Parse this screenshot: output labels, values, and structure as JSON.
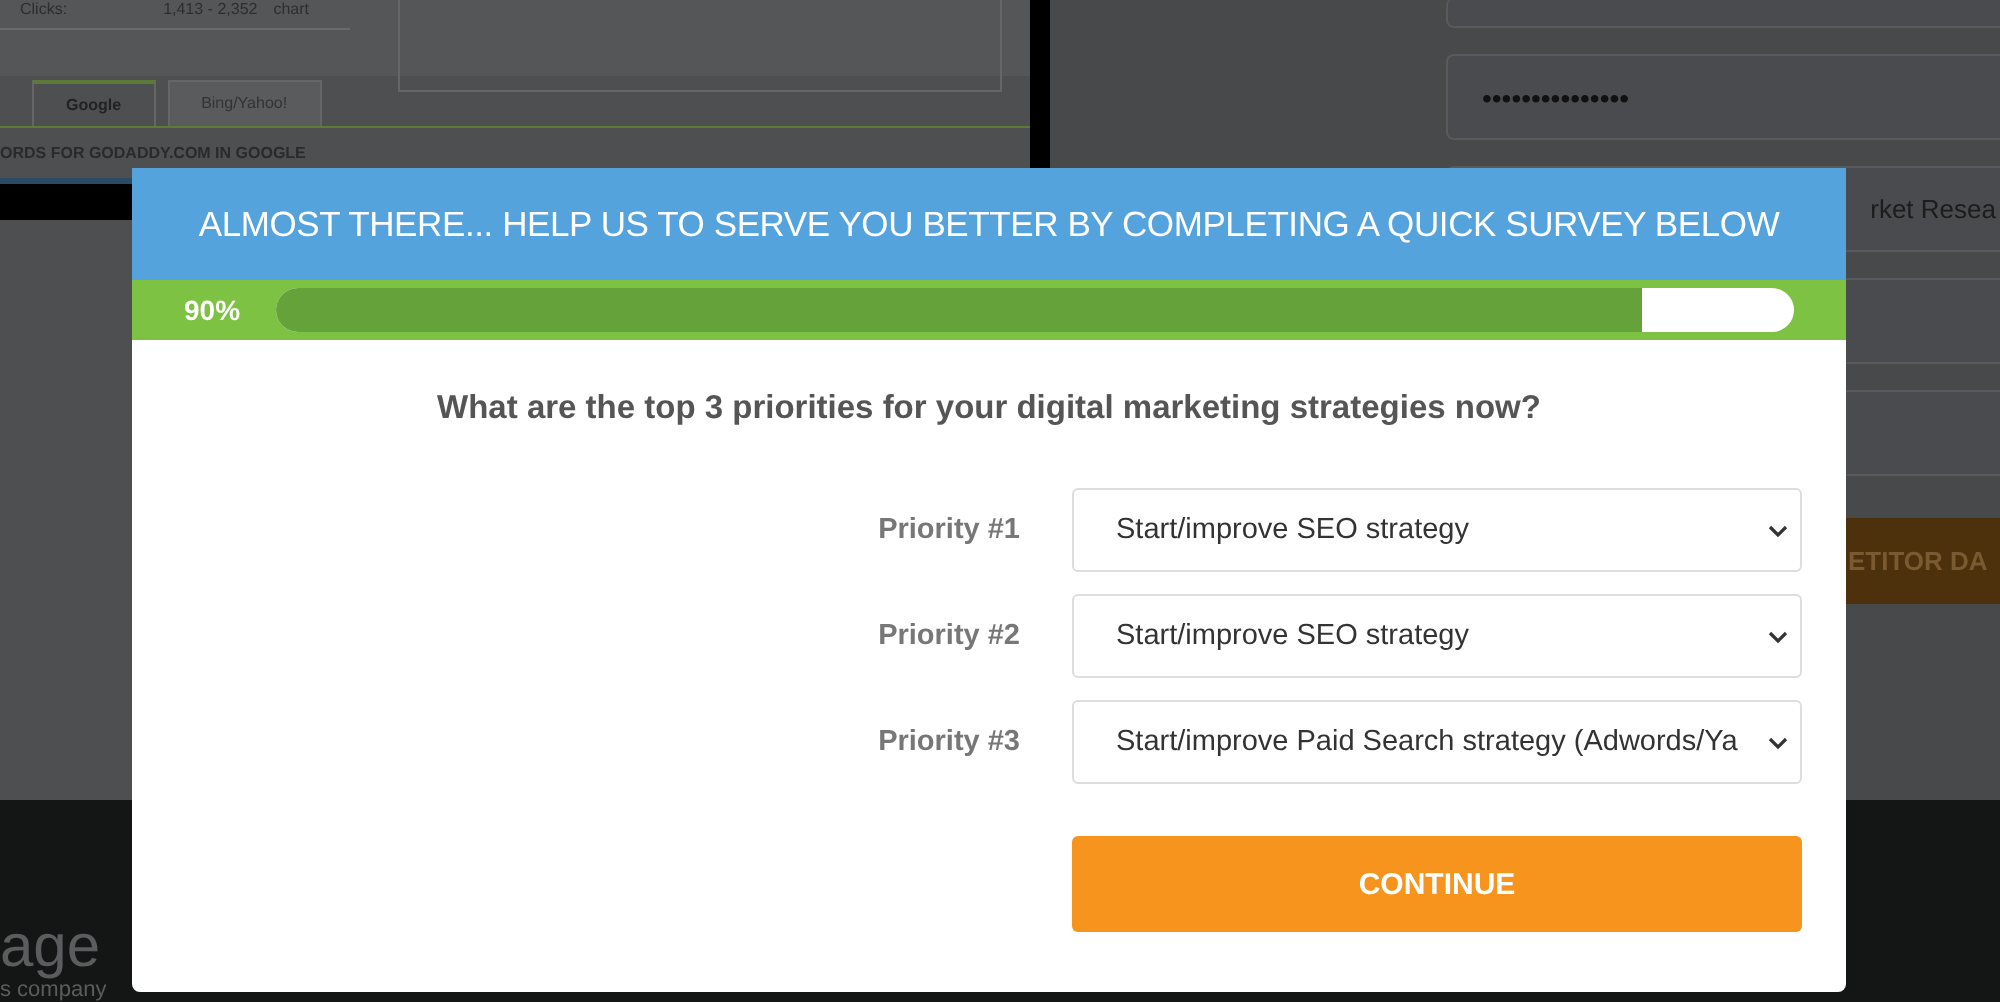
{
  "background": {
    "stats": {
      "label": "Clicks:",
      "value": "1,413 - 2,352",
      "link": "chart"
    },
    "tabs": [
      {
        "label": "Google",
        "selected": true
      },
      {
        "label": "Bing/Yahoo!",
        "selected": false
      }
    ],
    "heading": "ORDS FOR GODADDY.COM IN GOOGLE",
    "form": {
      "password": "•••••••••••••••",
      "field_3": "rket Resea",
      "button": "ETITOR DA"
    },
    "footer": {
      "logo": "age",
      "tagline": "s company"
    }
  },
  "modal": {
    "title": "ALMOST THERE... HELP US TO SERVE YOU BETTER BY COMPLETING A QUICK SURVEY BELOW",
    "progress": {
      "reading": "90%",
      "level": 0.9
    },
    "question": "What are the top 3 priorities for your digital marketing strategies now?",
    "priorities": [
      {
        "label": "Priority #1",
        "value": "Start/improve SEO strategy"
      },
      {
        "label": "Priority #2",
        "value": "Start/improve SEO strategy"
      },
      {
        "label": "Priority #3",
        "value": "Start/improve Paid Search strategy (Adwords/Ya"
      }
    ],
    "button": "CONTINUE"
  }
}
